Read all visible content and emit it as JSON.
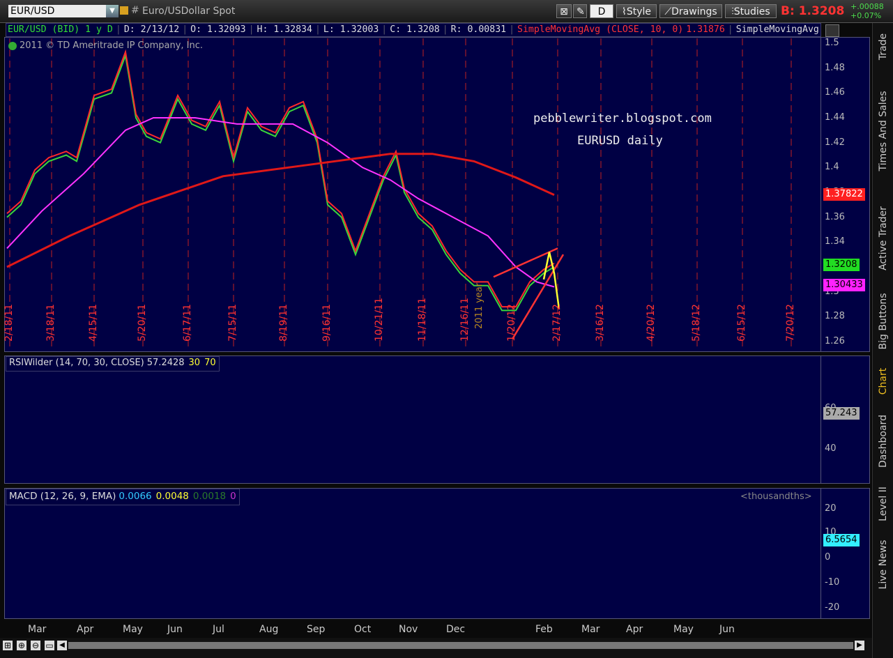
{
  "toolbar": {
    "symbol": "EUR/USD",
    "hash": "#",
    "description": "Euro/USDollar Spot",
    "period_btn": "D",
    "style_btn": "Style",
    "drawings_btn": "Drawings",
    "studies_btn": "Studies",
    "bid": "B: 1.3208",
    "change": "+.00088",
    "change_pct": "+0.07%"
  },
  "info": {
    "symbol": "EUR/USD (BID) 1 y D",
    "date": "D: 2/13/12",
    "open": "O: 1.32093",
    "high": "H: 1.32834",
    "low": "L: 1.32003",
    "close": "C: 1.3208",
    "range": "R: 0.00831",
    "sma10": "SimpleMovingAvg (CLOSE, 10, 0)",
    "sma10_val": "1.31876",
    "sma_more": "SimpleMovingAvg (CL..."
  },
  "copyright": "2011 © TD Ameritrade IP Company, Inc.",
  "watermark": [
    "pebblewriter.blogspot.com",
    "EURUSD daily"
  ],
  "year_label": "2011 year",
  "price_axis": [
    "1.5",
    "1.48",
    "1.46",
    "1.44",
    "1.42",
    "1.4",
    "1.38",
    "1.36",
    "1.34",
    "1.32",
    "1.3",
    "1.28",
    "1.26"
  ],
  "price_tags": {
    "sma200": "1.37822",
    "last": "1.3208",
    "sma50": "1.30433"
  },
  "expiry_dates": [
    "2/18/11",
    "3/18/11",
    "4/15/11",
    "5/20/11",
    "6/17/11",
    "7/15/11",
    "8/19/11",
    "9/16/11",
    "10/21/11",
    "11/18/11",
    "12/16/11",
    "1/20/12",
    "2/17/12",
    "3/16/12",
    "4/20/12",
    "5/18/12",
    "6/15/12",
    "7/20/12"
  ],
  "rsi": {
    "title": "RSIWilder (14, 70, 30, CLOSE)",
    "value": "57.2428",
    "oversold": "30",
    "overbought": "70",
    "axis": [
      "60",
      "40"
    ],
    "tag": "57.243"
  },
  "macd": {
    "title": "MACD (12, 26, 9, EMA)",
    "value": "0.0066",
    "avg": "0.0048",
    "diff": "0.0018",
    "zero": "0",
    "units": "<thousandths>",
    "axis": [
      "20",
      "10",
      "0",
      "-10",
      "-20"
    ],
    "tag": "6.5654"
  },
  "months": [
    "Mar",
    "Apr",
    "May",
    "Jun",
    "Jul",
    "Aug",
    "Sep",
    "Oct",
    "Nov",
    "Dec",
    "Feb",
    "Mar",
    "Apr",
    "May",
    "Jun"
  ],
  "rail_tabs": [
    "Trade",
    "Times And Sales",
    "Active Trader",
    "Big Buttons",
    "Chart",
    "Dashboard",
    "Level II",
    "Live News"
  ],
  "colors": {
    "panel_bg": "#000044",
    "grid_red": "#c02020",
    "sma10": "#ff2a2a",
    "sma50": "#ff33ff",
    "sma200": "#e01818",
    "price": "#3ad63a",
    "rsi_line": "#9a9a9a",
    "macd_line": "#33ccff",
    "macd_avg": "#ffff33"
  }
}
